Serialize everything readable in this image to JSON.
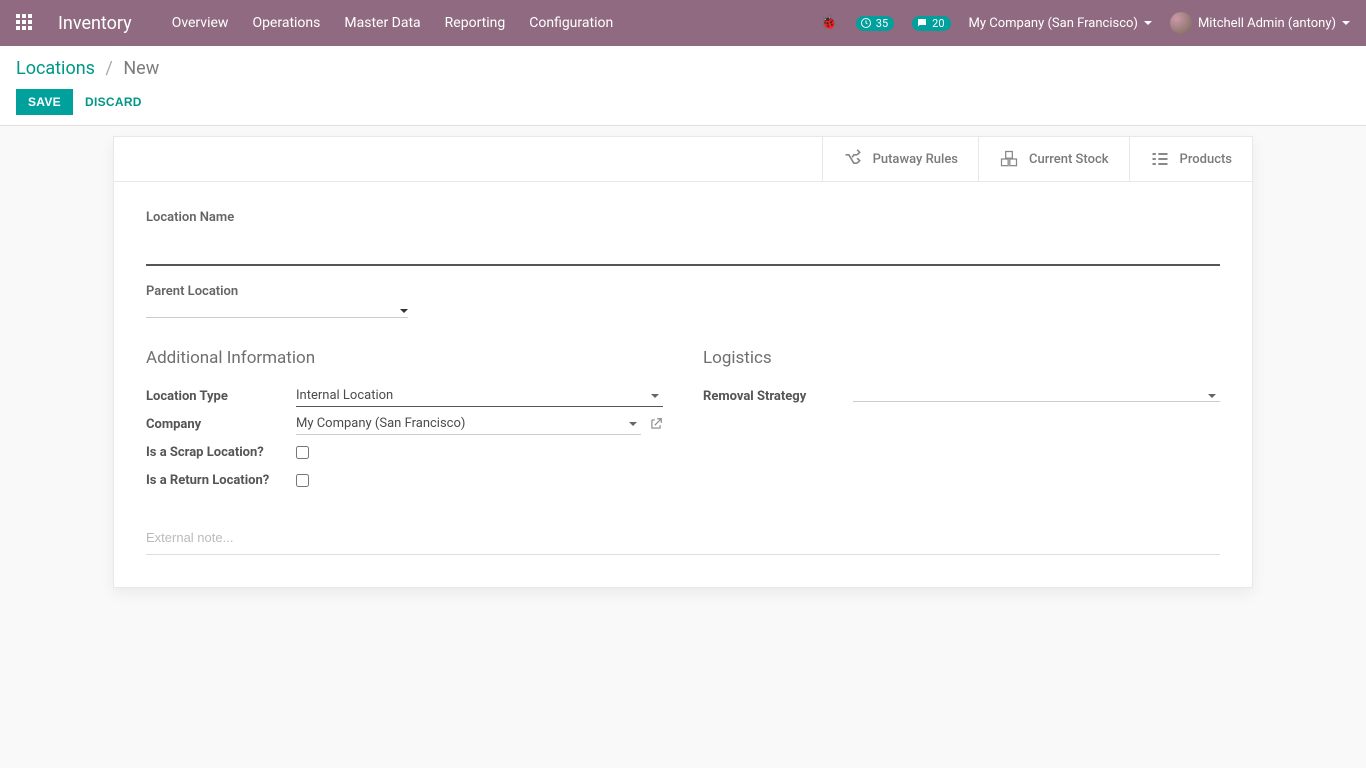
{
  "navbar": {
    "brand": "Inventory",
    "menu": [
      "Overview",
      "Operations",
      "Master Data",
      "Reporting",
      "Configuration"
    ],
    "activity_count": "35",
    "messages_count": "20",
    "company": "My Company (San Francisco)",
    "user": "Mitchell Admin (antony)"
  },
  "breadcrumb": {
    "root": "Locations",
    "current": "New"
  },
  "actions": {
    "save": "SAVE",
    "discard": "DISCARD"
  },
  "stat_buttons": {
    "putaway": "Putaway Rules",
    "stock": "Current Stock",
    "products": "Products"
  },
  "form": {
    "location_name_label": "Location Name",
    "location_name_value": "",
    "parent_location_label": "Parent Location",
    "parent_location_value": "",
    "section_additional": "Additional Information",
    "section_logistics": "Logistics",
    "location_type_label": "Location Type",
    "location_type_value": "Internal Location",
    "company_label": "Company",
    "company_value": "My Company (San Francisco)",
    "scrap_label": "Is a Scrap Location?",
    "return_label": "Is a Return Location?",
    "removal_label": "Removal Strategy",
    "removal_value": "",
    "note_placeholder": "External note..."
  }
}
